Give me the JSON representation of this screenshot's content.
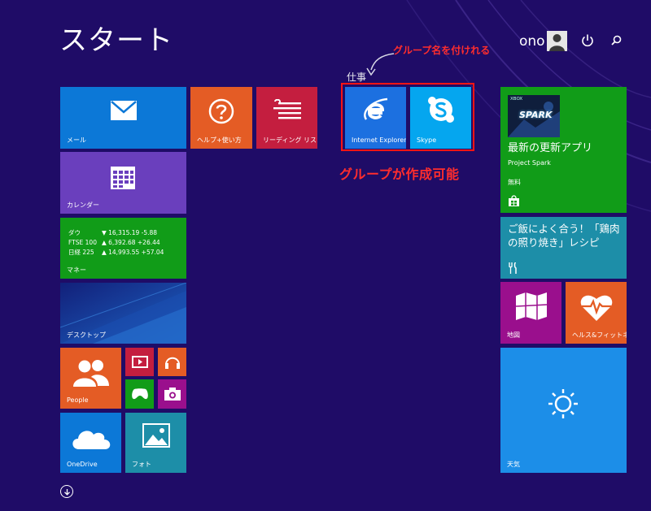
{
  "header": {
    "title": "スタート",
    "user_name": "ono"
  },
  "annotations": {
    "group_naming": "グループ名を付けれる",
    "group_creatable": "グループが作成可能"
  },
  "group": {
    "name": "仕事"
  },
  "tiles": {
    "mail": "メール",
    "help": "ヘルプ+使い方",
    "reading_list": "リーディング リスト",
    "calendar": "カレンダー",
    "money": "マネー",
    "desktop": "デスクトップ",
    "people": "People",
    "onedrive": "OneDrive",
    "photos": "フォト",
    "internet_explorer": "Internet Explorer",
    "skype": "Skype",
    "maps": "地図",
    "health": "ヘルス&フィットネス",
    "weather": "天気"
  },
  "money_rows": [
    {
      "name": "ダウ",
      "value": "▼ 16,315.19 -5.88"
    },
    {
      "name": "FTSE 100",
      "value": "▲ 6,392.68 +26.44"
    },
    {
      "name": "日経 225",
      "value": "▲ 14,993.55 +57.04"
    }
  ],
  "store_tile": {
    "badge": "XBOX",
    "game_logo": "SPARK",
    "title": "最新の更新アプリ",
    "subtitle": "Project Spark",
    "price": "無料"
  },
  "food_tile": {
    "title": "ご飯によく合う！「鶏肉の照り焼き」レシピ"
  },
  "colors": {
    "background": "#1f0c67",
    "blue": "#0c78d7",
    "orange": "#e45c25",
    "red": "#c41e3f",
    "purple": "#6a3fbd",
    "green": "#119c18",
    "teal": "#1d8ea8",
    "magenta": "#9a0f8d",
    "sky": "#1c8ee8",
    "annotation": "#ff2d2d"
  }
}
